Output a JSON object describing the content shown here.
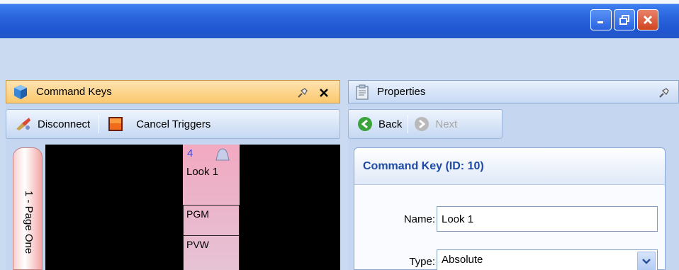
{
  "window": {
    "minimize_icon": "minimize-icon",
    "restore_icon": "restore-icon",
    "close_icon": "close-icon"
  },
  "command_keys_panel": {
    "title": "Command Keys",
    "toolbar": {
      "disconnect_label": "Disconnect",
      "cancel_triggers_label": "Cancel Triggers"
    },
    "page_tab_label": "1 - Page One",
    "command_key": {
      "number": "4",
      "label": "Look 1",
      "sub_items": [
        "PGM",
        "PVW"
      ]
    }
  },
  "properties_panel": {
    "title": "Properties",
    "toolbar": {
      "back_label": "Back",
      "next_label": "Next"
    },
    "section_title": "Command Key (ID: 10)",
    "fields": {
      "name_label": "Name:",
      "name_value": "Look 1",
      "type_label": "Type:",
      "type_value": "Absolute"
    }
  },
  "colors": {
    "titlebar": "#2a64dc",
    "app_background": "#c9daf1",
    "active_panel_header": "#fbc86e",
    "command_key_fill": "#ecb3c8",
    "section_title": "#1e4aa6"
  }
}
